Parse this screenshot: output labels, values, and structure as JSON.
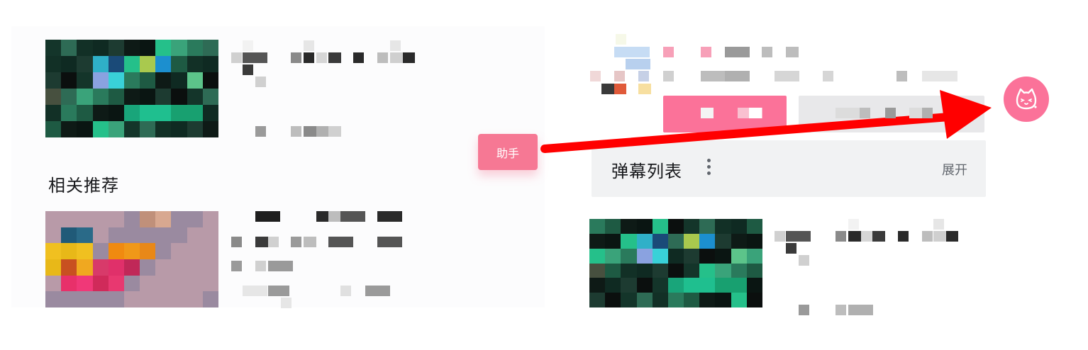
{
  "related": {
    "title": "相关推荐"
  },
  "assistant_tag": {
    "label": "助手"
  },
  "danmaku": {
    "title": "弹幕列表",
    "expand_label": "展开"
  },
  "colors": {
    "accent_pink": "#fb7299",
    "annotation_red": "#ff0000",
    "panel_gray": "#f1f2f3"
  },
  "icons": {
    "assistant": "cat-face-icon",
    "menu": "more-vertical-icon"
  }
}
